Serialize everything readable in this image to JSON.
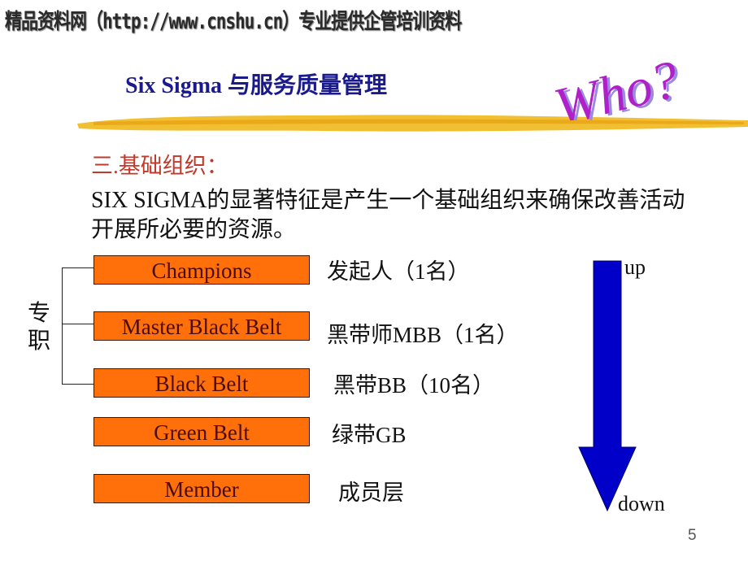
{
  "watermark": "精品资料网（http://www.cnshu.cn）专业提供企管培训资料",
  "header": {
    "title": "Six Sigma 与服务质量管理",
    "decoration_text": "Who?"
  },
  "section": {
    "heading": "三.基础组织：",
    "intro": "SIX SIGMA的显著特征是产生一个基础组织来确保改善活动开展所必要的资源。"
  },
  "bracket": {
    "label": "专职"
  },
  "roles": [
    {
      "name": "Champions",
      "description": "发起人（1名）"
    },
    {
      "name": "Master Black Belt",
      "description": "黑带师MBB（1名）"
    },
    {
      "name": "Black Belt",
      "description": "黑带BB（10名）"
    },
    {
      "name": "Green Belt",
      "description": "绿带GB"
    },
    {
      "name": "Member",
      "description": "成员层"
    }
  ],
  "hierarchy_arrow": {
    "top_label": "up",
    "bottom_label": "down"
  },
  "page_number": "5",
  "colors": {
    "title": "#1a1a8c",
    "heading": "#c0392b",
    "box_fill": "#ff6f0a",
    "box_text": "#4a0d0d",
    "arrow": "#0000c8",
    "who_text": "#b020c8",
    "brush": "#f0b81c"
  }
}
